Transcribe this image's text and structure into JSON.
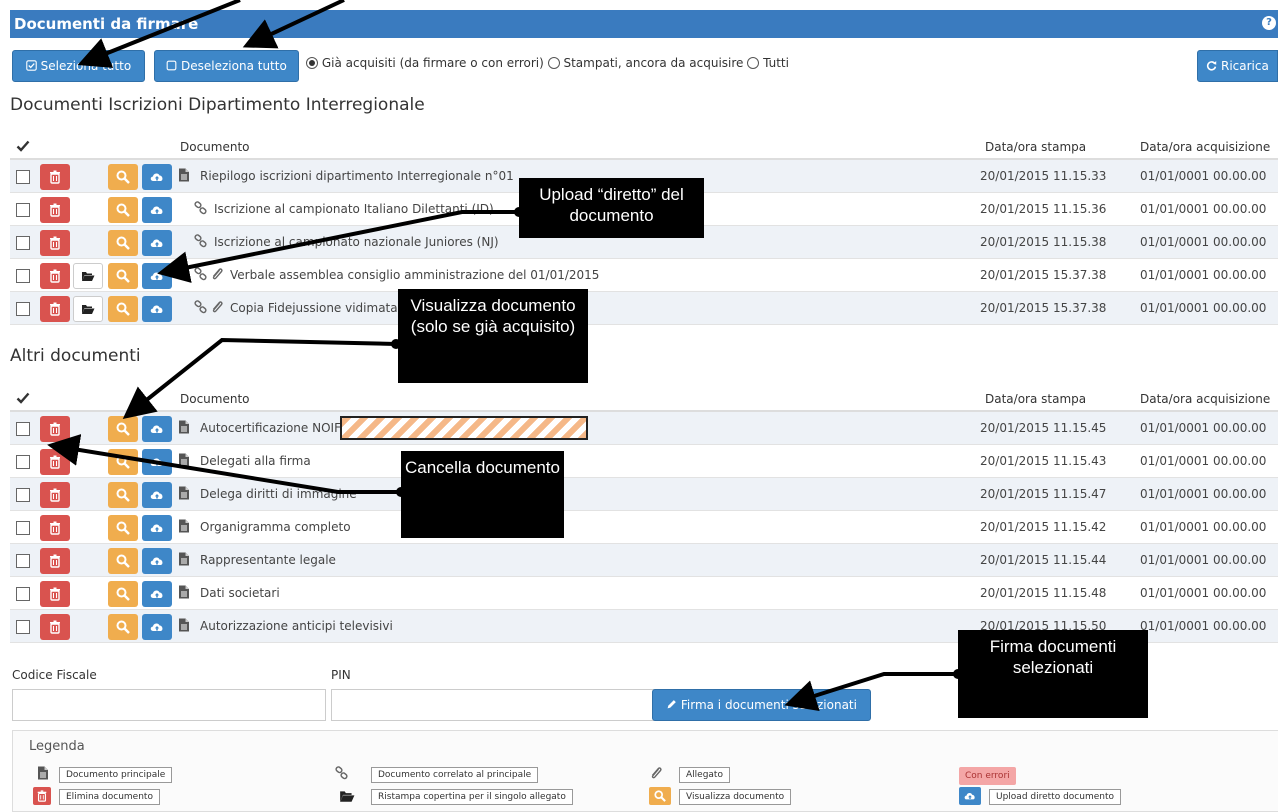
{
  "header": {
    "title": "Documenti da firmare",
    "help_icon": "question-circle-icon"
  },
  "toolbar": {
    "select_all": "Seleziona tutto",
    "deselect_all": "Deseleziona tutto",
    "filters": [
      {
        "label": "Già acquisiti (da firmare o con errori)",
        "selected": true
      },
      {
        "label": "Stampati, ancora da acquisire",
        "selected": false
      },
      {
        "label": "Tutti",
        "selected": false
      }
    ],
    "reload": "Ricarica"
  },
  "columns": {
    "document": "Documento",
    "printed": "Data/ora stampa",
    "acquired": "Data/ora acquisizione"
  },
  "section1": {
    "title": "Documenti Iscrizioni Dipartimento Interregionale",
    "rows": [
      {
        "name": "Riepilogo iscrizioni dipartimento Interregionale n°01",
        "printed": "20/01/2015 11.15.33",
        "acquired": "01/01/0001 00.00.00"
      },
      {
        "name": "Iscrizione al campionato Italiano Dilettanti (ID)",
        "printed": "20/01/2015 11.15.36",
        "acquired": "01/01/0001 00.00.00"
      },
      {
        "name": "Iscrizione al campionato nazionale Juniores (NJ)",
        "printed": "20/01/2015 11.15.38",
        "acquired": "01/01/0001 00.00.00"
      },
      {
        "name": "Verbale assemblea consiglio amministrazione del 01/01/2015",
        "printed": "20/01/2015 15.37.38",
        "acquired": "01/01/0001 00.00.00"
      },
      {
        "name": "Copia Fidejussione vidimata",
        "printed": "20/01/2015 15.37.38",
        "acquired": "01/01/0001 00.00.00"
      }
    ]
  },
  "section2": {
    "title": "Altri documenti",
    "rows": [
      {
        "name": "Autocertificazione NOIF",
        "printed": "20/01/2015 11.15.45",
        "acquired": "01/01/0001 00.00.00"
      },
      {
        "name": "Delegati alla firma",
        "printed": "20/01/2015 11.15.43",
        "acquired": "01/01/0001 00.00.00"
      },
      {
        "name": "Delega diritti di immagine",
        "printed": "20/01/2015 11.15.47",
        "acquired": "01/01/0001 00.00.00"
      },
      {
        "name": "Organigramma completo",
        "printed": "20/01/2015 11.15.42",
        "acquired": "01/01/0001 00.00.00"
      },
      {
        "name": "Rappresentante legale",
        "printed": "20/01/2015 11.15.44",
        "acquired": "01/01/0001 00.00.00"
      },
      {
        "name": "Dati societari",
        "printed": "20/01/2015 11.15.48",
        "acquired": "01/01/0001 00.00.00"
      },
      {
        "name": "Autorizzazione anticipi televisivi",
        "printed": "20/01/2015 11.15.50",
        "acquired": "01/01/0001 00.00.00"
      }
    ]
  },
  "form": {
    "codice_fiscale_label": "Codice Fiscale",
    "pin_label": "PIN",
    "sign_button": "Firma i documenti selezionati"
  },
  "legend": {
    "title": "Legenda",
    "items": {
      "main_doc": "Documento principale",
      "related_doc": "Documento correlato al principale",
      "attachment": "Allegato",
      "errors": "Con errori",
      "delete_doc": "Elimina documento",
      "reprint_cover": "Ristampa copertina per il singolo allegato",
      "view_doc": "Visualizza documento",
      "direct_upload": "Upload diretto documento"
    }
  },
  "callouts": {
    "upload": "Upload “diretto” del documento",
    "view": "Visualizza documento (solo se già acquisito)",
    "delete": "Cancella documento",
    "sign": "Firma documenti selezionati"
  },
  "colors": {
    "primary": "#3e87c8",
    "danger": "#d9534f",
    "warning": "#f0ad4e",
    "header": "#3a7bbf"
  }
}
